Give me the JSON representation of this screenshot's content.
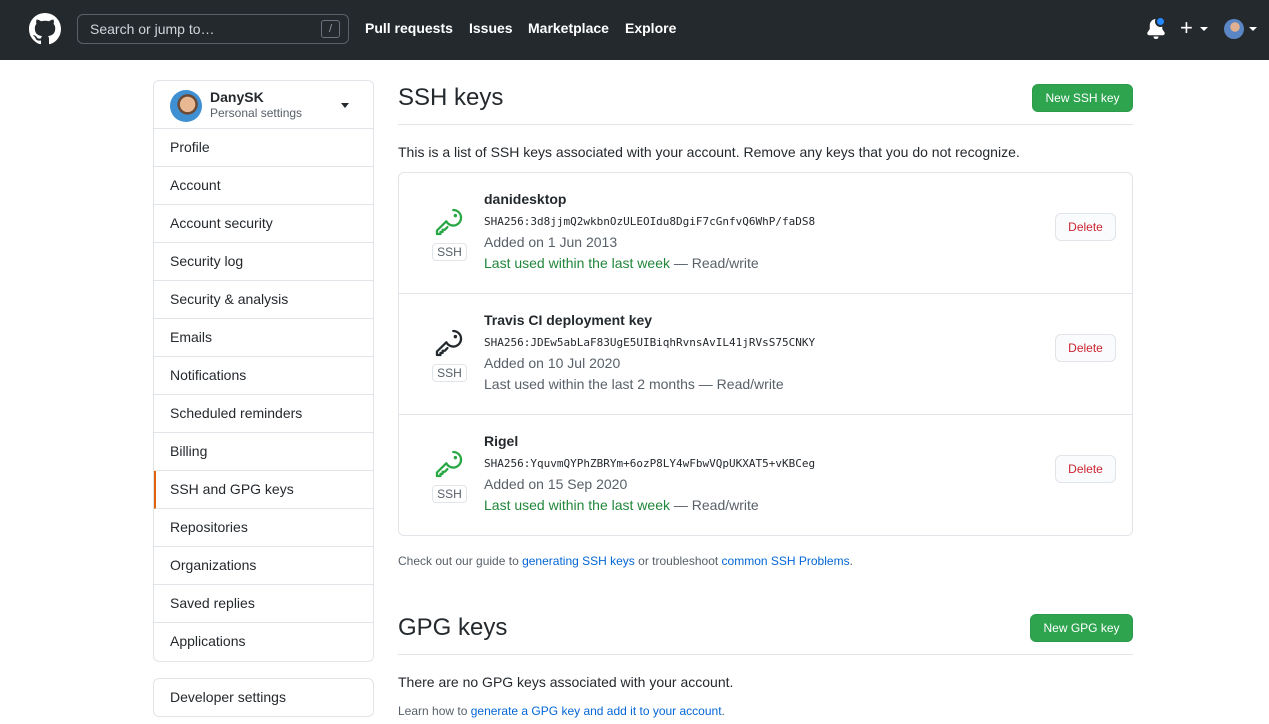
{
  "header": {
    "search_placeholder": "Search or jump to…",
    "slash_key": "/",
    "nav": [
      "Pull requests",
      "Issues",
      "Marketplace",
      "Explore"
    ],
    "plus": "+"
  },
  "sidebar": {
    "username": "DanySK",
    "subtitle": "Personal settings",
    "items": [
      {
        "label": "Profile"
      },
      {
        "label": "Account"
      },
      {
        "label": "Account security"
      },
      {
        "label": "Security log"
      },
      {
        "label": "Security & analysis"
      },
      {
        "label": "Emails"
      },
      {
        "label": "Notifications"
      },
      {
        "label": "Scheduled reminders"
      },
      {
        "label": "Billing"
      },
      {
        "label": "SSH and GPG keys",
        "selected": true
      },
      {
        "label": "Repositories"
      },
      {
        "label": "Organizations"
      },
      {
        "label": "Saved replies"
      },
      {
        "label": "Applications"
      }
    ],
    "developer_settings": "Developer settings"
  },
  "ssh": {
    "title": "SSH keys",
    "new_button": "New SSH key",
    "intro": "This is a list of SSH keys associated with your account. Remove any keys that you do not recognize.",
    "badge": "SSH",
    "delete_label": "Delete",
    "keys": [
      {
        "title": "danidesktop",
        "fingerprint": "SHA256:3d8jjmQ2wkbnOzULEOIdu8DgiF7cGnfvQ6WhP/faDS8",
        "added": "Added on 1 Jun 2013",
        "last_used": "Last used within the last week",
        "access": " — Read/write",
        "recent": true
      },
      {
        "title": "Travis CI deployment key",
        "fingerprint": "SHA256:JDEw5abLaF83UgE5UIBiqhRvnsAvIL41jRVsS75CNKY",
        "added": "Added on 10 Jul 2020",
        "last_used": "Last used within the last 2 months",
        "access": " — Read/write",
        "recent": false
      },
      {
        "title": "Rigel",
        "fingerprint": "SHA256:YquvmQYPhZBRYm+6ozP8LY4wFbwVQpUKXAT5+vKBCeg",
        "added": "Added on 15 Sep 2020",
        "last_used": "Last used within the last week",
        "access": " — Read/write",
        "recent": true
      }
    ],
    "guide_prefix": "Check out our guide to ",
    "guide_link": "generating SSH keys",
    "guide_mid": " or troubleshoot ",
    "guide_link2": "common SSH Problems",
    "guide_suffix": "."
  },
  "gpg": {
    "title": "GPG keys",
    "new_button": "New GPG key",
    "empty": "There are no GPG keys associated with your account.",
    "learn_prefix": "Learn how to ",
    "learn_link": "generate a GPG key and add it to your account",
    "learn_suffix": "."
  },
  "colors": {
    "accent_green": "#2ea44f",
    "recent_green": "#22863a",
    "danger": "#cb2431",
    "selected_border": "#e36209",
    "header_bg": "#24292e"
  }
}
